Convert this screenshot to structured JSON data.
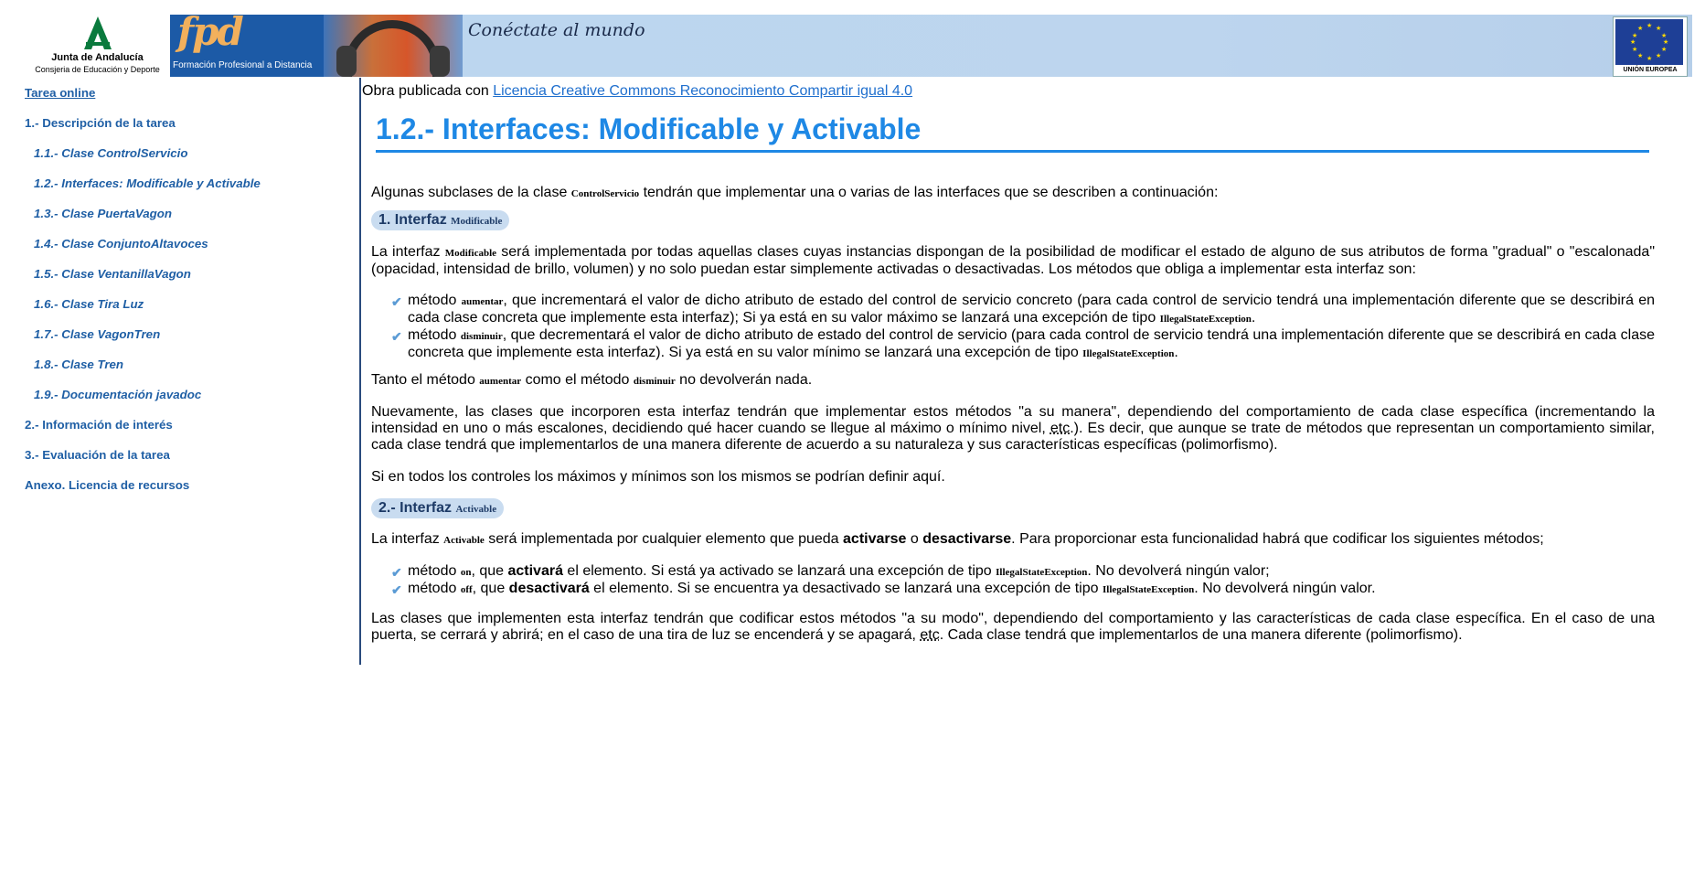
{
  "header": {
    "junta_name": "Junta de Andalucía",
    "junta_dept": "Consjeria de Educación y Deporte",
    "fpd_logo": "fpd",
    "fpd_caption": "Formación Profesional a Distancia",
    "slogan": "Conéctate al mundo",
    "eu_caption": "UNIÓN EUROPEA",
    "colors": {
      "banner": "#bcd6ef",
      "fpd_bg": "#1c5aa6",
      "eu_flag": "#1e3f96"
    }
  },
  "sidebar": {
    "items": [
      {
        "label": "Tarea online",
        "level": 1
      },
      {
        "label": "1.- Descripción de la tarea",
        "level": 1
      },
      {
        "label": "1.1.- Clase ControlServicio",
        "level": 2
      },
      {
        "label": "1.2.- Interfaces: Modificable y Activable",
        "level": 2
      },
      {
        "label": "1.3.- Clase PuertaVagon",
        "level": 2
      },
      {
        "label": "1.4.- Clase ConjuntoAltavoces",
        "level": 2
      },
      {
        "label": "1.5.- Clase VentanillaVagon",
        "level": 2
      },
      {
        "label": "1.6.- Clase Tira Luz",
        "level": 2
      },
      {
        "label": "1.7.- Clase VagonTren",
        "level": 2
      },
      {
        "label": "1.8.- Clase Tren",
        "level": 2
      },
      {
        "label": "1.9.- Documentación javadoc",
        "level": 2
      },
      {
        "label": "2.- Información de interés",
        "level": 1
      },
      {
        "label": "3.- Evaluación de la tarea",
        "level": 1
      },
      {
        "label": "Anexo. Licencia de recursos",
        "level": 1
      }
    ],
    "color": "#1f5fa5"
  },
  "content": {
    "licence_prefix": "Obra publicada con ",
    "licence_link": "Licencia Creative Commons Reconocimiento Compartir igual 4.0",
    "title": "1.2.- Interfaces: Modificable y Activable",
    "title_color": "#1e88e5",
    "intro": {
      "a": "Algunas subclases de la clase ",
      "code": "ControlServicio",
      "b": " tendrán que implementar una o varias de las interfaces que se describen a continuación:"
    },
    "section1": {
      "heading": "1. Interfaz ",
      "heading_code": "Modificable",
      "p1": {
        "a": "La interfaz ",
        "code": "Modificable",
        "b": " será implementada por todas aquellas clases cuyas instancias dispongan de la posibilidad de modificar el estado de alguno de sus atributos de forma \"gradual\" o \"escalonada\" (opacidad, intensidad de brillo, volumen) y no solo puedan estar simplemente activadas o desactivadas. Los métodos que obliga a implementar esta interfaz son:"
      },
      "items": [
        {
          "a": "método ",
          "code": "aumentar",
          "b": ", que incrementará el valor de dicho atributo de estado del control de servicio concreto (para cada control de servicio tendrá una implementación diferente que se describirá en cada clase concreta que implemente esta interfaz); Si ya está en su valor máximo se lanzará una excepción de tipo ",
          "code2": "IllegalStateException",
          "c": "."
        },
        {
          "a": "método ",
          "code": "disminuir",
          "b": ", que decrementará el valor de dicho atributo de estado del control de servicio (para cada control de servicio tendrá una implementación diferente que se describirá en cada clase concreta que implemente esta interfaz). Si ya está en su valor mínimo se lanzará una excepción de tipo ",
          "code2": "IllegalStateException",
          "c": "."
        }
      ],
      "p2": {
        "a": "Tanto el método ",
        "code": "aumentar",
        "b": " como el método ",
        "code2": "disminuir",
        "c": " no devolverán nada."
      },
      "p3": {
        "a": "Nuevamente, las clases que incorporen esta interfaz tendrán que implementar estos métodos \"a su manera\", dependiendo del comportamiento de cada clase específica (incrementando la intensidad en uno o más escalones, decidiendo qué hacer cuando se llegue al máximo o mínimo nivel, ",
        "abbr": "etc",
        "b": ".). Es decir, que aunque se trate de métodos que representan un comportamiento similar, cada clase tendrá que implementarlos de una manera diferente de acuerdo a su naturaleza y sus características específicas (polimorfismo)."
      },
      "p4": "Si en todos los controles los máximos y mínimos son los mismos se podrían definir aquí."
    },
    "section2": {
      "heading": "2.- Interfaz ",
      "heading_code": "Activable",
      "p1": {
        "a": "La interfaz ",
        "code": "Activable",
        "b": " será implementada por cualquier elemento que pueda ",
        "bold1": "activarse",
        "c": " o ",
        "bold2": "desactivarse",
        "d": ". Para proporcionar esta funcionalidad habrá que codificar los siguientes métodos;"
      },
      "items": [
        {
          "a": "método ",
          "code": "on",
          "b": ", que ",
          "bold": "activará",
          "c": " el elemento. Si está ya activado se lanzará una excepción de tipo ",
          "code2": "IllegalStateException",
          "d": ". No devolverá ningún valor;"
        },
        {
          "a": "método ",
          "code": "off",
          "b": ", que ",
          "bold": "desactivará",
          "c": " el elemento. Si se encuentra ya desactivado se lanzará una excepción de tipo ",
          "code2": "IllegalStateException",
          "d": ". No devolverá ningún valor."
        }
      ],
      "p2": {
        "a": "Las clases que implementen esta interfaz tendrán que codificar estos métodos \"a su modo\", dependiendo del comportamiento y las características de cada clase específica. En el caso de una puerta, se cerrará y abrirá; en el caso de una tira de luz se encenderá y se apagará, ",
        "abbr": "etc",
        "b": ". Cada clase tendrá que implementarlos de una manera diferente (polimorfismo)."
      }
    }
  }
}
